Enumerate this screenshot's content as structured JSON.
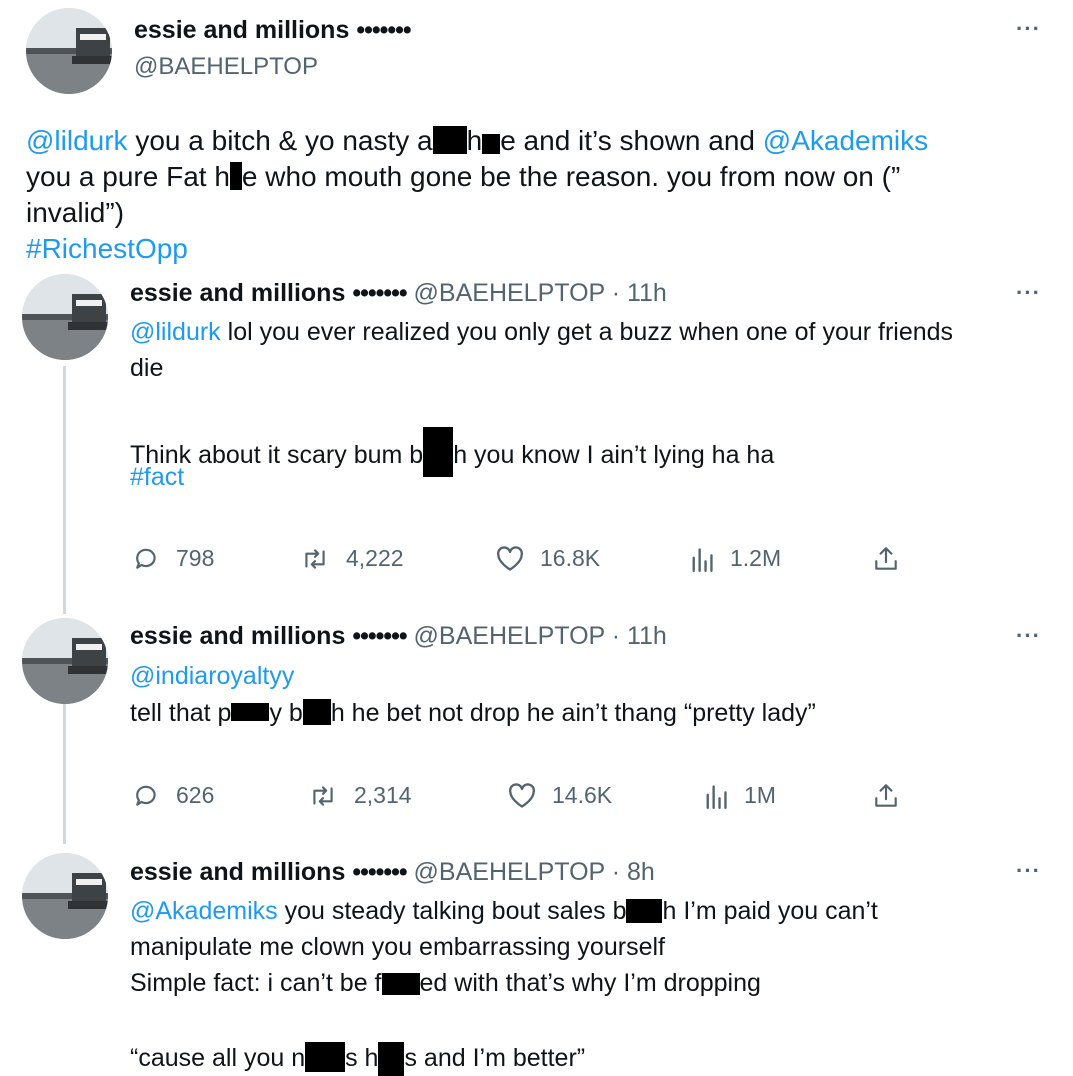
{
  "main_post": {
    "display_name": "essie and millions",
    "name_suffix": "•••••••",
    "handle": "@BAEHELPTOP",
    "more": "···",
    "line1": {
      "mention1": "@lildurk",
      "a": " you a bitch & yo nasty a",
      "b": "h",
      "c": "e and it’s shown and ",
      "mention2": "@Akademiks"
    },
    "line2": {
      "a": "you a pure Fat h",
      "b": "e who mouth gone be the reason. you from now on (”"
    },
    "line3": "invalid”)",
    "hashtag": "#RichestOpp"
  },
  "replies": [
    {
      "display_name": "essie and millions",
      "name_suffix": "•••••••",
      "handle_time": "@BAEHELPTOP · 11h",
      "more": "···",
      "mention": "@lildurk",
      "line1": " lol you ever realized you only get a buzz when one of your friends",
      "line2": "die",
      "line3a": "Think about it scary bum b",
      "line3b": "h you know I ain’t lying ha ha",
      "hashtag": "#fact",
      "stats": {
        "replies": "798",
        "reposts": "4,222",
        "likes": "16.8K",
        "views": "1.2M"
      }
    },
    {
      "display_name": "essie and millions",
      "name_suffix": "•••••••",
      "handle_time": "@BAEHELPTOP · 11h",
      "more": "···",
      "mention": "@indiaroyaltyy",
      "line1a": "tell that p",
      "line1b": "y b",
      "line1c": "h he bet not drop he ain’t thang “pretty lady”",
      "stats": {
        "replies": "626",
        "reposts": "2,314",
        "likes": "14.6K",
        "views": "1M"
      }
    },
    {
      "display_name": "essie and millions",
      "name_suffix": "•••••••",
      "handle_time": "@BAEHELPTOP · 8h",
      "more": "···",
      "mention": "@Akademiks",
      "line1a": " you steady talking bout sales b",
      "line1b": "h I’m paid you can’t",
      "line2": "manipulate me clown you embarrassing yourself",
      "line3a": "Simple fact:  i can’t be f",
      "line3b": "ed with that’s why I’m dropping",
      "line4a": "“cause all you n",
      "line4b": "s h",
      "line4c": "s and I’m better”"
    }
  ],
  "icons": {
    "reply": "reply-icon",
    "repost": "repost-icon",
    "like": "like-icon",
    "views": "views-icon",
    "share": "share-icon",
    "more": "more-icon"
  },
  "colors": {
    "link": "#1d9bf0",
    "secondary": "#536471",
    "thread": "#cfd9de"
  }
}
